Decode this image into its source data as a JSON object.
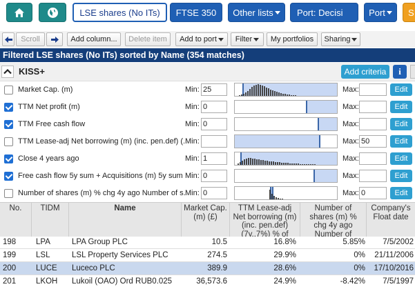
{
  "nav": {
    "list_tab": "LSE shares (No ITs)",
    "ftse_tab": "FTSE 350",
    "other_lists": "Other lists",
    "port_decision": "Port: Decisi",
    "port": "Port",
    "s_tab": "S"
  },
  "toolbar": {
    "scroll": "Scroll",
    "add_column": "Add column...",
    "delete_item": "Delete item",
    "add_to_port": "Add to port",
    "filter": "Filter",
    "my_portfolios": "My portfolios",
    "sharing": "Sharing"
  },
  "filter_title": "Filtered LSE shares (No ITs) sorted by Name (354 matches)",
  "criteria_header": {
    "name": "KISS+",
    "add_criteria": "Add criteria",
    "info": "i"
  },
  "criteria_labels": {
    "min": "Min:",
    "max": "Max:",
    "edit": "Edit"
  },
  "criteria": [
    {
      "checked": false,
      "name": "Market Cap. (m)",
      "min": "25",
      "max": ""
    },
    {
      "checked": true,
      "name": "TTM Net profit (m)",
      "min": "0",
      "max": ""
    },
    {
      "checked": true,
      "name": "TTM Free cash flow",
      "min": "0",
      "max": ""
    },
    {
      "checked": false,
      "name": "TTM Lease-adj Net borrowing (m) (inc. pen.def) (...",
      "min": "",
      "max": "50"
    },
    {
      "checked": true,
      "name": "Close 4 years ago",
      "min": "1",
      "max": ""
    },
    {
      "checked": true,
      "name": "Free cash flow 5y sum + Acquisitions (m) 5y sum",
      "min": "0",
      "max": ""
    },
    {
      "checked": false,
      "name": "Number of shares (m) % chg 4y ago Number of s...",
      "min": "0",
      "max": "0"
    }
  ],
  "table": {
    "headers": {
      "no": "No.",
      "tidm": "TIDM",
      "name": "Name",
      "mcap": "Market Cap. (m) (£)",
      "borrow": "TTM Lease-adj Net borrowing (m) (inc. pen.def) (7y..7%) % of",
      "shares": "Number of shares (m) % chg 4y ago Number of",
      "float": "Company's Float date"
    },
    "rows": [
      {
        "no": "198",
        "tidm": "LPA",
        "name": "LPA Group PLC",
        "mcap": "10.5",
        "borrow": "16.8%",
        "shares": "5.85%",
        "float": "7/5/2002"
      },
      {
        "no": "199",
        "tidm": "LSL",
        "name": "LSL Property Services PLC",
        "mcap": "274.5",
        "borrow": "29.9%",
        "shares": "0%",
        "float": "21/11/2006"
      },
      {
        "no": "200",
        "tidm": "LUCE",
        "name": "Luceco PLC",
        "mcap": "389.9",
        "borrow": "28.6%",
        "shares": "0%",
        "float": "17/10/2016"
      },
      {
        "no": "201",
        "tidm": "LKOH",
        "name": "Lukoil (OAO) Ord RUB0.025",
        "mcap": "36,573.6",
        "borrow": "24.9%",
        "shares": "-8.42%",
        "float": "7/5/1997"
      }
    ]
  },
  "colors": {
    "nav_blue": "#1f5fb4",
    "nav_teal": "#1f8a8a",
    "title_bar": "#143e7a",
    "edit_button": "#2e9fd0",
    "selected_row": "#c9d8ee"
  }
}
